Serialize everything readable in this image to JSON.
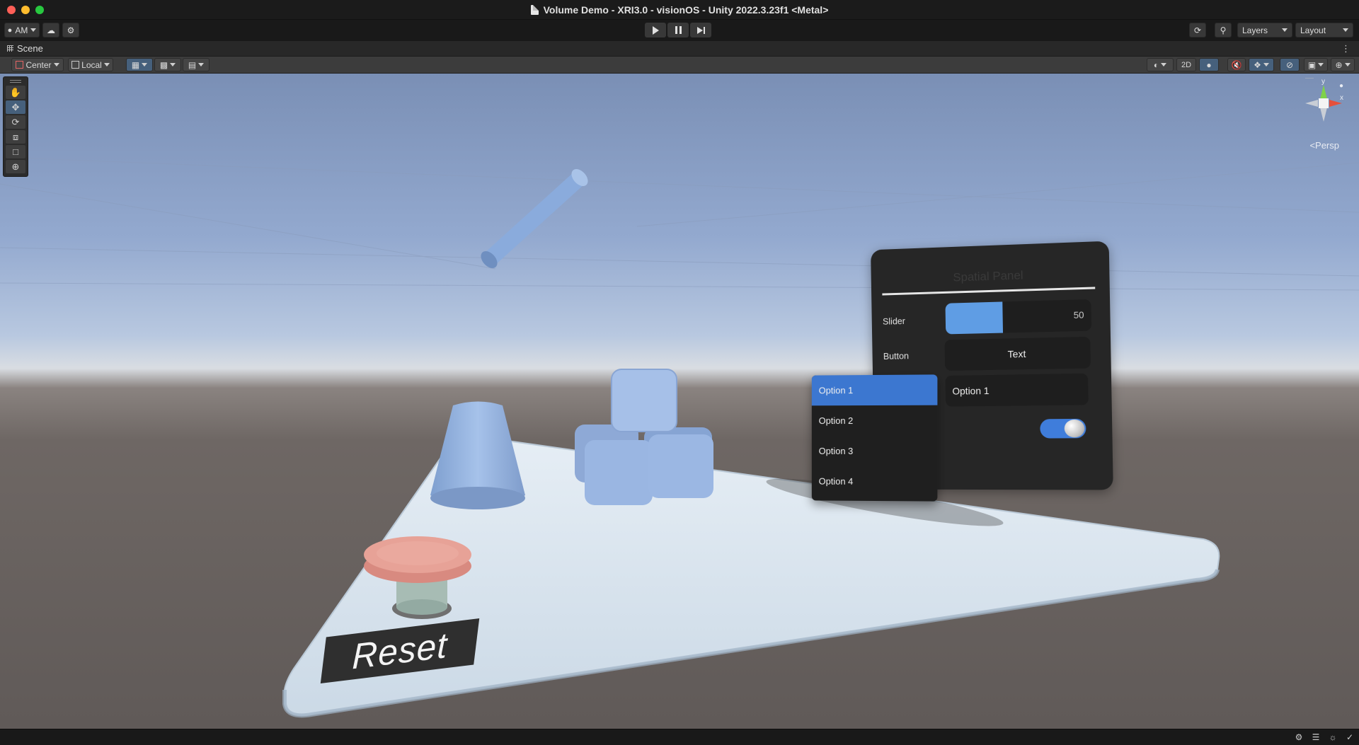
{
  "window": {
    "title": "Volume Demo - XRI3.0 - visionOS - Unity 2022.3.23f1 <Metal>"
  },
  "toolbar": {
    "account_label": "AM",
    "layers_label": "Layers",
    "layout_label": "Layout"
  },
  "scene_tab": {
    "label": "Scene"
  },
  "scene_toolbar": {
    "pivot_label": "Center",
    "space_label": "Local",
    "mode_2d_label": "2D"
  },
  "gizmo": {
    "y_label": "y",
    "x_label": "x",
    "projection_label": "Persp"
  },
  "spatial_panel": {
    "title": "Spatial Panel",
    "slider_label": "Slider",
    "slider_value": "50",
    "slider_fraction": 0.4,
    "button_label": "Button",
    "button_text": "Text",
    "dropdown_selected": "Option 1",
    "toggle_on": true
  },
  "dropdown_options": [
    "Option 1",
    "Option 2",
    "Option 3",
    "Option 4"
  ],
  "scene": {
    "reset_label": "Reset"
  },
  "colors": {
    "accent": "#3c77d0",
    "slider_fill": "#5f9de4",
    "object_blue": "#8eb0e0",
    "button_cap": "#e39a8f"
  }
}
